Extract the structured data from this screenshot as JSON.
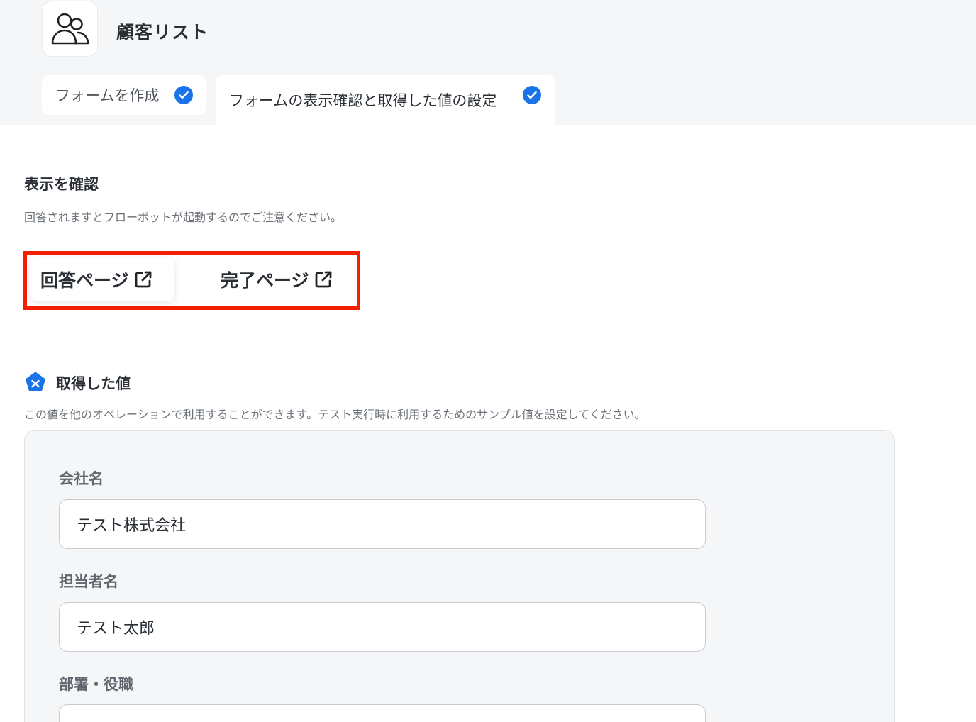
{
  "app": {
    "title": "顧客リスト",
    "icon": "users-icon"
  },
  "tabs": [
    {
      "label": "フォームを作成",
      "completed": true
    },
    {
      "label": "フォームの表示確認と取得した値の設定",
      "completed": true
    }
  ],
  "display_check": {
    "title": "表示を確認",
    "description": "回答されますとフローボットが起動するのでご注意ください。",
    "buttons": [
      {
        "label": "回答ページ",
        "icon": "external-link-icon"
      },
      {
        "label": "完了ページ",
        "icon": "external-link-icon"
      }
    ]
  },
  "acquired_values": {
    "title": "取得した値",
    "description": "この値を他のオペレーションで利用することができます。テスト実行時に利用するためのサンプル値を設定してください。",
    "fields": [
      {
        "label": "会社名",
        "value": "テスト株式会社"
      },
      {
        "label": "担当者名",
        "value": "テスト太郎"
      },
      {
        "label": "部署・役職",
        "value": ""
      }
    ]
  },
  "colors": {
    "accent": "#1a73e8",
    "highlight": "#f41e00",
    "background": "#f5f6f8"
  }
}
